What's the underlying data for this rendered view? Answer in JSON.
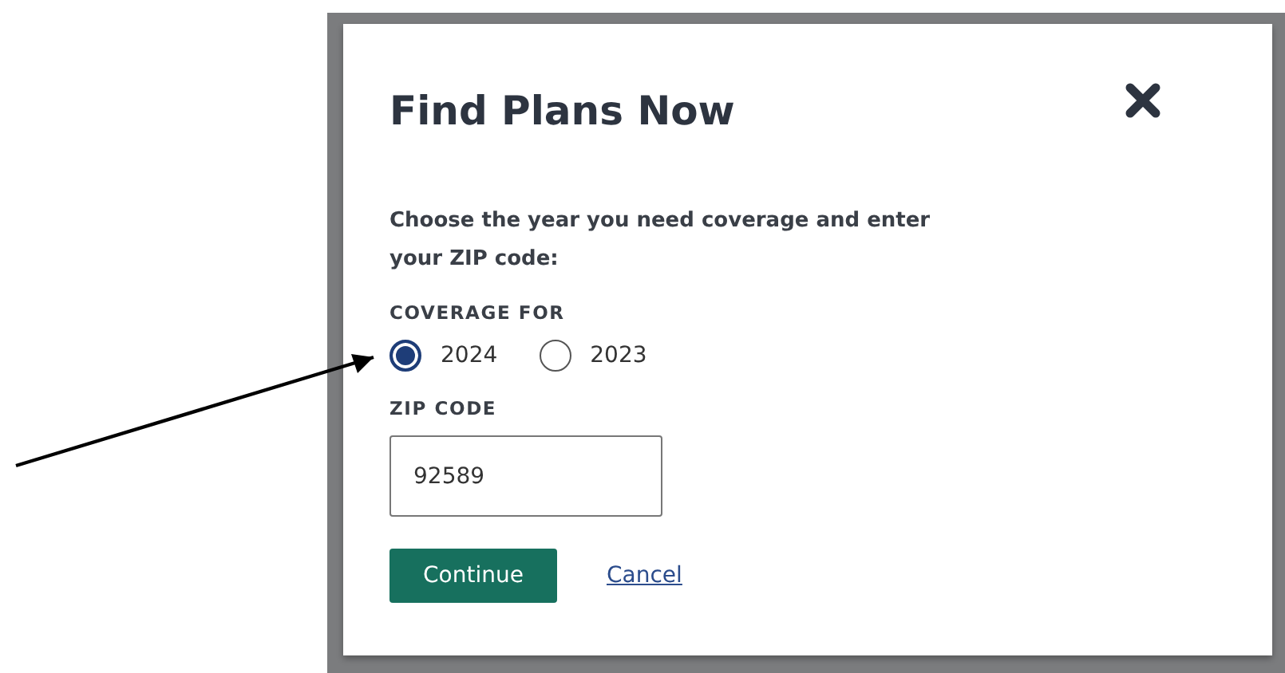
{
  "dialog": {
    "title": "Find Plans Now",
    "description": "Choose the year you need coverage and enter your ZIP code:",
    "coverage": {
      "label": "COVERAGE FOR",
      "options": [
        {
          "label": "2024",
          "selected": true
        },
        {
          "label": "2023",
          "selected": false
        }
      ]
    },
    "zip": {
      "label": "ZIP CODE",
      "value": "92589"
    },
    "actions": [
      {
        "kind": "primary",
        "label": "Continue"
      },
      {
        "kind": "link",
        "label": "Cancel"
      }
    ]
  }
}
